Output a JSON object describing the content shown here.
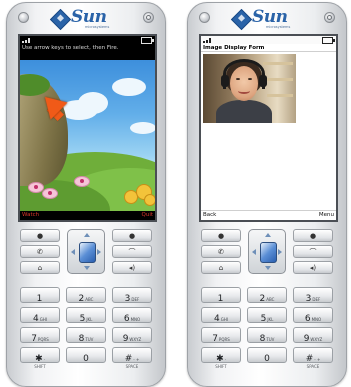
{
  "brand": {
    "name": "Sun",
    "tagline": "microsystems"
  },
  "left_phone": {
    "hint": "Use arrow keys to select, then Fire.",
    "soft_left": "Watch",
    "soft_right": "Quit"
  },
  "right_phone": {
    "form_title": "Image Display Form",
    "soft_left": "Back",
    "soft_right": "Menu"
  },
  "nav_keys": [
    "●",
    "●",
    "✆",
    "⌒",
    "⌂",
    "◂)"
  ],
  "keys": [
    {
      "digit": "1",
      "letters": "",
      "sub": ""
    },
    {
      "digit": "2",
      "letters": "ABC",
      "sub": ""
    },
    {
      "digit": "3",
      "letters": "DEF",
      "sub": ""
    },
    {
      "digit": "4",
      "letters": "GHI",
      "sub": ""
    },
    {
      "digit": "5",
      "letters": "JKL",
      "sub": ""
    },
    {
      "digit": "6",
      "letters": "MNO",
      "sub": ""
    },
    {
      "digit": "7",
      "letters": "PQRS",
      "sub": ""
    },
    {
      "digit": "8",
      "letters": "TUV",
      "sub": ""
    },
    {
      "digit": "9",
      "letters": "WXYZ",
      "sub": ""
    },
    {
      "digit": "✱",
      "letters": "·",
      "sub": "SHIFT"
    },
    {
      "digit": "0",
      "letters": "",
      "sub": ""
    },
    {
      "digit": "#",
      "letters": "- +",
      "sub": "SPACE"
    }
  ]
}
